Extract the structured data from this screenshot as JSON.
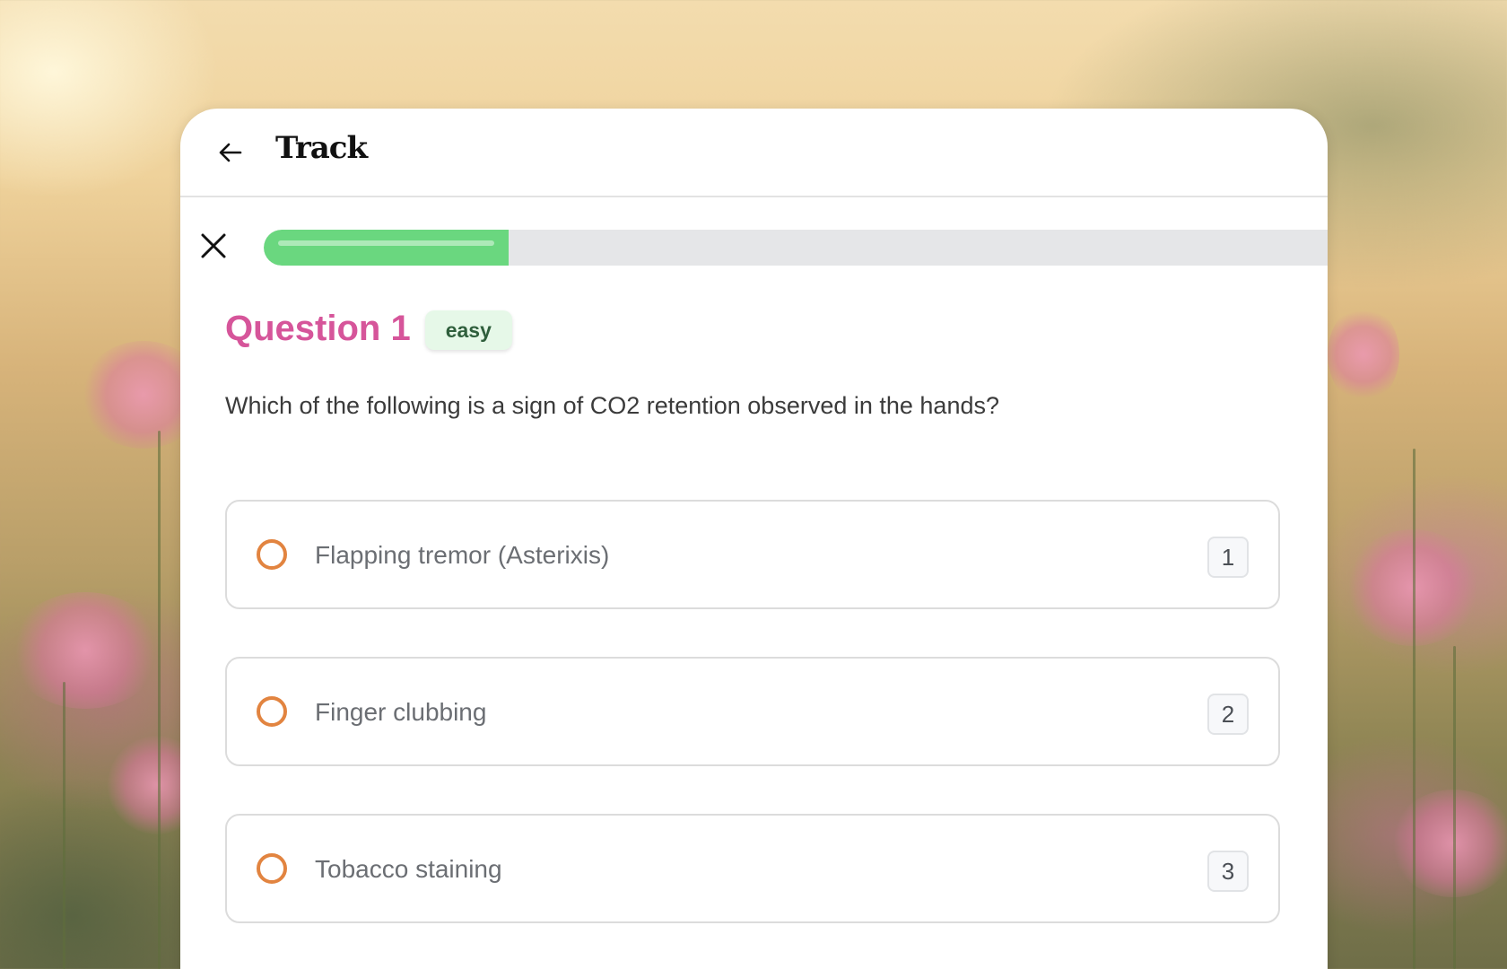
{
  "header": {
    "title": "Track",
    "back_icon": "arrow-left-icon"
  },
  "quiz": {
    "close_icon": "close-icon",
    "progress_fraction": 0.23,
    "progress_color": "#6ad77f",
    "question_label": "Question 1",
    "difficulty": "easy",
    "question_text": "Which of the following is a sign of CO2 retention observed in the hands?",
    "options": [
      {
        "label": "Flapping tremor (Asterixis)",
        "key": "1"
      },
      {
        "label": "Finger clubbing",
        "key": "2"
      },
      {
        "label": "Tobacco staining",
        "key": "3"
      }
    ]
  },
  "colors": {
    "question_accent": "#d6559a",
    "radio_accent": "#e28440",
    "badge_bg": "#e6f8e8"
  }
}
